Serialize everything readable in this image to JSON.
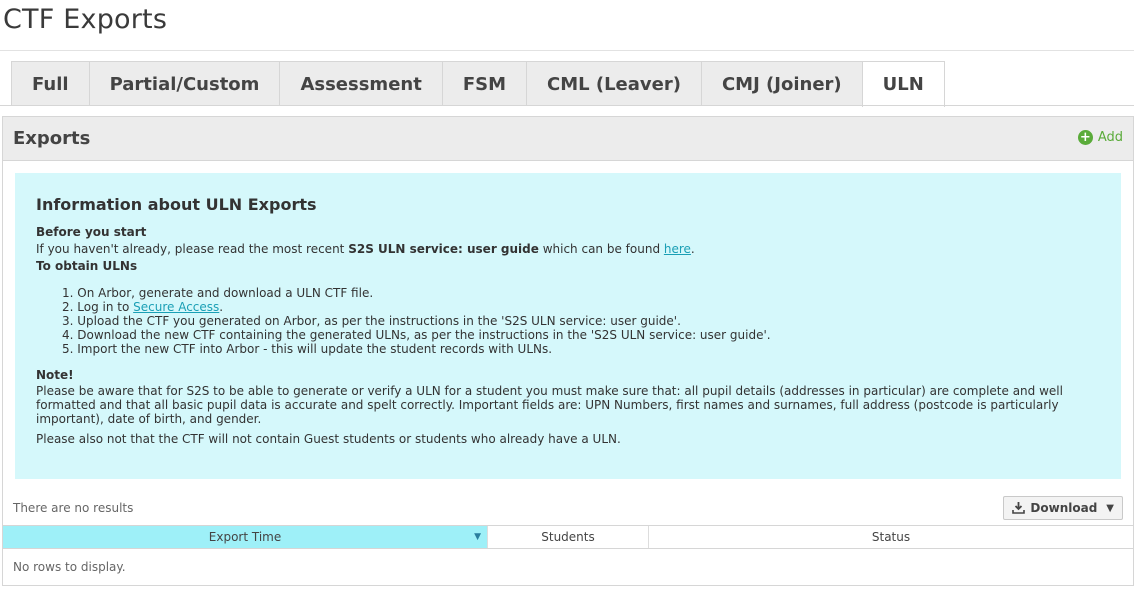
{
  "page": {
    "title": "CTF Exports"
  },
  "tabs": [
    {
      "label": "Full",
      "active": false
    },
    {
      "label": "Partial/Custom",
      "active": false
    },
    {
      "label": "Assessment",
      "active": false
    },
    {
      "label": "FSM",
      "active": false
    },
    {
      "label": "CML (Leaver)",
      "active": false
    },
    {
      "label": "CMJ (Joiner)",
      "active": false
    },
    {
      "label": "ULN",
      "active": true
    }
  ],
  "panel": {
    "title": "Exports",
    "add_label": "Add",
    "add_icon": "plus-circle-icon",
    "add_color": "#5aab3a"
  },
  "info": {
    "title": "Information about ULN Exports",
    "before_heading": "Before you start",
    "before_text_1": "If you haven't already, please read the most recent ",
    "before_text_bold": "S2S ULN service: user guide",
    "before_text_2": " which can be found ",
    "before_link": "here",
    "before_text_3": ".",
    "obtain_heading": "To obtain ULNs",
    "steps": {
      "s1": "1. On Arbor, generate and download a ULN CTF file.",
      "s2_pre": "2. Log in to ",
      "s2_link": "Secure Access",
      "s2_post": ".",
      "s3": "3. Upload the CTF you generated on Arbor, as per the instructions in the 'S2S ULN service: user guide'.",
      "s4": "4. Download the new CTF containing the generated ULNs, as per the instructions in the 'S2S ULN service: user guide'.",
      "s5": "5. Import the new CTF into Arbor - this will update the student records with ULNs."
    },
    "note_heading": "Note!",
    "note_text_1": "Please be aware that for S2S to be able to generate or verify a ULN for a student you must make sure that: all pupil details (addresses in particular) are complete and well formatted and that all basic pupil data is accurate and spelt correctly. Important fields are: UPN Numbers, first names and surnames, full address (postcode is particularly important), date of birth, and gender.",
    "note_text_2": "Please also not that the CTF will not contain Guest students or students who already have a ULN.",
    "background": "#d5f8fb"
  },
  "results": {
    "status": "There are no results",
    "download_label": "Download",
    "download_icon": "download-icon"
  },
  "table": {
    "columns": [
      "Export Time",
      "Students",
      "Status"
    ],
    "sorted_column": "Export Time",
    "sort_icon": "sort-desc-icon",
    "empty_text": "No rows to display."
  }
}
